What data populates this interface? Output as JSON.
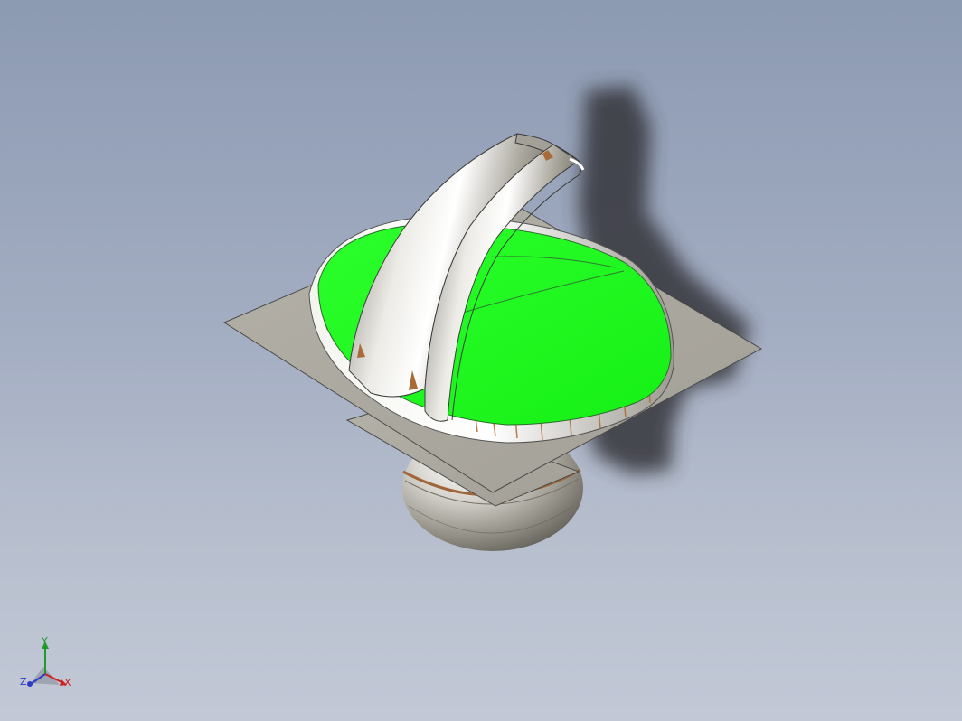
{
  "viewport": {
    "background_top": "#8c9ab2",
    "background_bottom": "#c2c8d6"
  },
  "model": {
    "surface_color": "#c8c6bd",
    "highlight_face_color": "#22ff22",
    "edge_color": "#3c3c3c",
    "shadow_color": "#3d3f45"
  },
  "triad": {
    "x_label": "X",
    "y_label": "Y",
    "z_label": "Z",
    "x_color": "#cc2222",
    "y_color": "#1f9a2b",
    "z_color": "#2a3cc8",
    "icon": "coordinate-triad-icon"
  }
}
